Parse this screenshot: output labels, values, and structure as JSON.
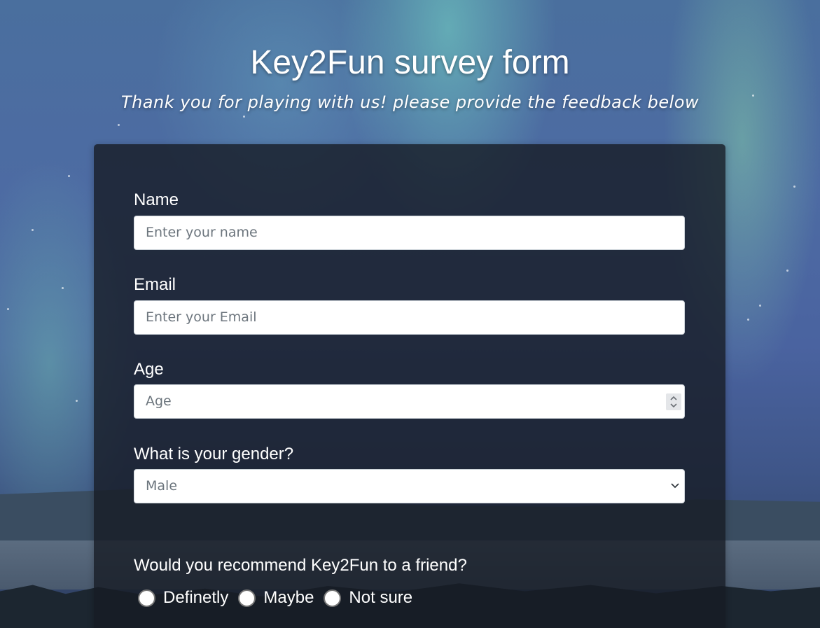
{
  "header": {
    "title": "Key2Fun survey form",
    "subtitle": "Thank you for playing with us! please provide the feedback below"
  },
  "form": {
    "name": {
      "label": "Name",
      "placeholder": "Enter your name",
      "value": ""
    },
    "email": {
      "label": "Email",
      "placeholder": "Enter your Email",
      "value": ""
    },
    "age": {
      "label": "Age",
      "placeholder": "Age",
      "value": ""
    },
    "gender": {
      "label": "What is your gender?",
      "selected": "Male"
    },
    "recommend": {
      "question": "Would you recommend Key2Fun to a friend?",
      "options": [
        "Definetly",
        "Maybe",
        "Not sure"
      ],
      "selected": null
    }
  },
  "icons": {
    "age_spinner": "number-spinner-icon",
    "gender_dropdown": "chevron-down-icon"
  },
  "colors": {
    "card_background": "#161b24",
    "input_background": "#ffffff",
    "placeholder_text": "#6c757d",
    "text": "#ffffff"
  }
}
